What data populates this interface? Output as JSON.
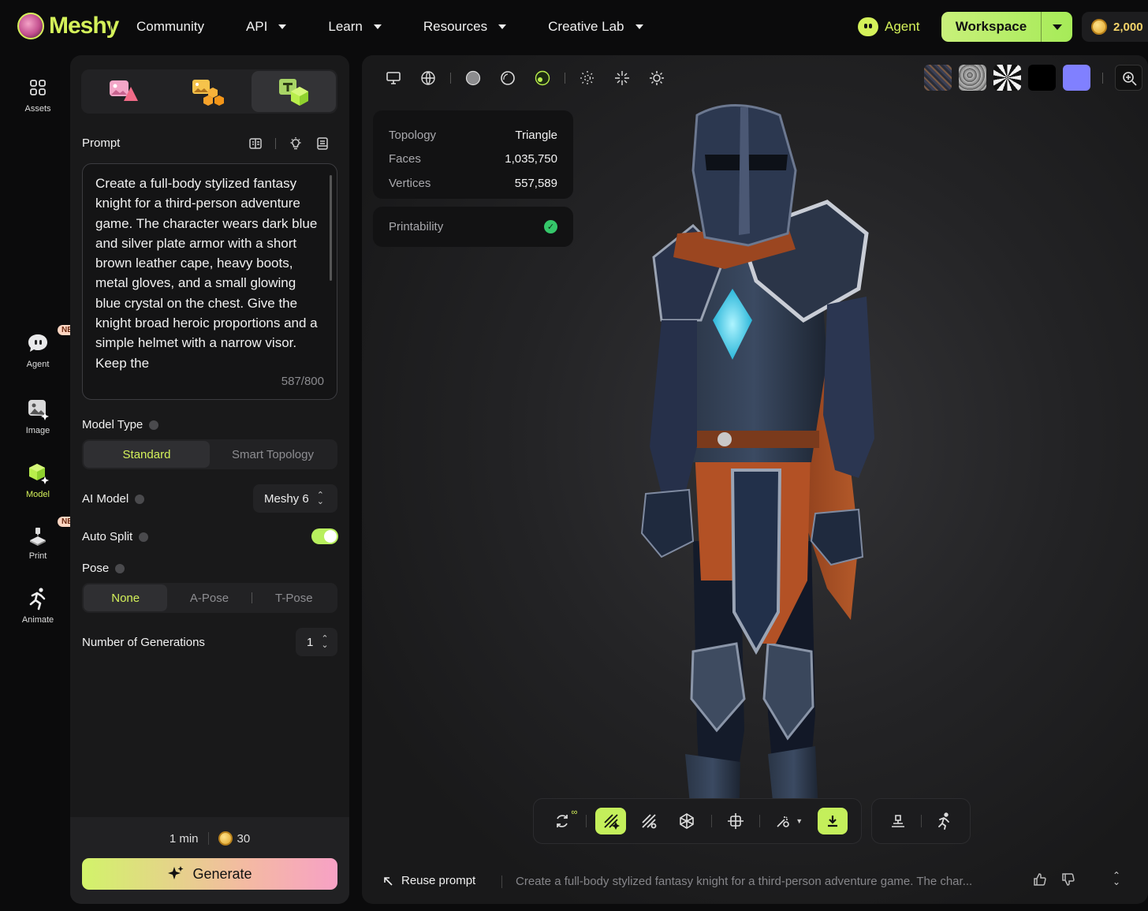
{
  "brand": {
    "name": "Meshy"
  },
  "nav": [
    {
      "label": "Community",
      "has_caret": false
    },
    {
      "label": "API",
      "has_caret": true
    },
    {
      "label": "Learn",
      "has_caret": true
    },
    {
      "label": "Resources",
      "has_caret": true
    },
    {
      "label": "Creative Lab",
      "has_caret": true
    }
  ],
  "header": {
    "agent_label": "Agent",
    "workspace_label": "Workspace",
    "credits": "2,000"
  },
  "rail": {
    "items": [
      {
        "label": "Assets",
        "badge": ""
      },
      {
        "label": "Agent",
        "badge": "NEW"
      },
      {
        "label": "Image",
        "badge": ""
      },
      {
        "label": "Model",
        "badge": ""
      },
      {
        "label": "Print",
        "badge": "NEW"
      },
      {
        "label": "Animate",
        "badge": ""
      }
    ],
    "active": "Model"
  },
  "panel": {
    "prompt_label": "Prompt",
    "prompt_text": "Create a full-body stylized fantasy knight for a third-person adventure game. The character wears dark blue and silver plate armor with a short brown leather cape, heavy boots, metal gloves, and a small glowing blue crystal on the chest. Give the knight broad heroic proportions and a simple helmet with a narrow visor. Keep the",
    "prompt_count": "587/800",
    "model_type_label": "Model Type",
    "model_types": [
      "Standard",
      "Smart Topology"
    ],
    "model_type_selected": "Standard",
    "ai_model_label": "AI Model",
    "ai_model_value": "Meshy 6",
    "auto_split_label": "Auto Split",
    "auto_split_on": true,
    "pose_label": "Pose",
    "poses": [
      "None",
      "A-Pose",
      "T-Pose"
    ],
    "pose_selected": "None",
    "generations_label": "Number of Generations",
    "generations_value": "1",
    "eta": "1 min",
    "cost": "30",
    "generate_label": "Generate"
  },
  "viewport": {
    "stats": [
      {
        "key": "Topology",
        "value": "Triangle"
      },
      {
        "key": "Faces",
        "value": "1,035,750"
      },
      {
        "key": "Vertices",
        "value": "557,589"
      }
    ],
    "printability_label": "Printability",
    "swatch_colors": [
      "#3a3f55",
      "#9a9a9a",
      "#f2f2f2",
      "#000000",
      "#8080ff"
    ],
    "reuse_label": "Reuse prompt",
    "reuse_prompt_preview": "Create a full-body stylized fantasy knight for a third-person adventure game. The char..."
  },
  "colors": {
    "accent": "#d4f15a",
    "toggle": "#b8ef5e",
    "check": "#35c76a"
  }
}
